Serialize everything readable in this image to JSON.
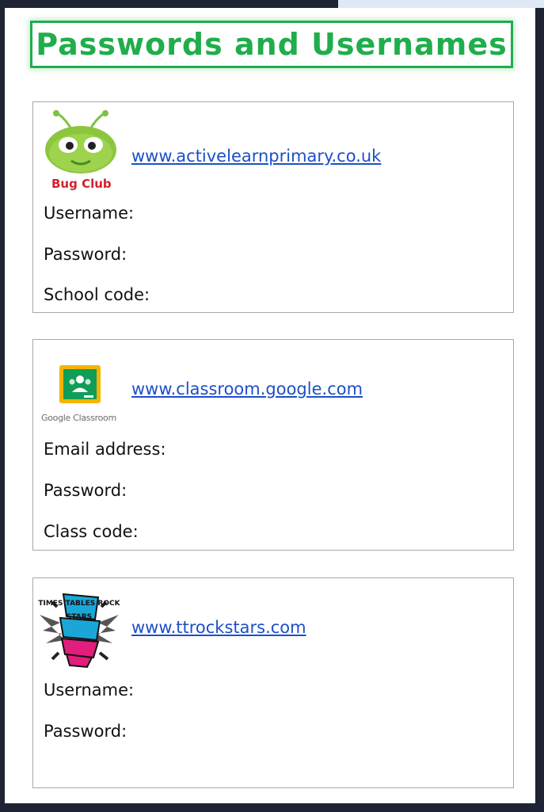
{
  "title": "Passwords and Usernames",
  "colors": {
    "title_green": "#1fae4b",
    "link_blue": "#1d4fc9",
    "frame": "#1e2433"
  },
  "cards": [
    {
      "logo_icon": "bug-club-logo",
      "logo_caption": "Bug Club",
      "link": "www.activelearnprimary.co.uk",
      "fields": [
        "Username:",
        "Password:",
        "School code:"
      ]
    },
    {
      "logo_icon": "google-classroom-logo",
      "logo_caption": "Google Classroom",
      "link": "www.classroom.google.com",
      "fields": [
        "Email address:",
        "Password:",
        "Class code:"
      ]
    },
    {
      "logo_icon": "times-tables-rockstars-logo",
      "logo_caption": "TIMES TABLES ROCK STARS",
      "link": "www.ttrockstars.com",
      "fields": [
        "Username:",
        "Password:"
      ]
    }
  ]
}
